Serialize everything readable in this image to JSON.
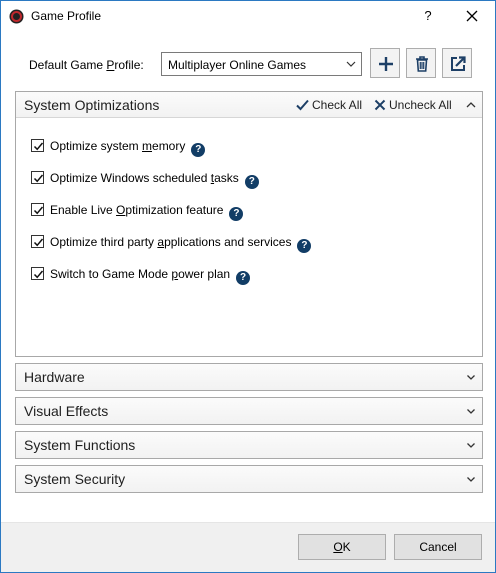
{
  "window": {
    "title": "Game Profile",
    "help_label": "?"
  },
  "profile": {
    "label_before": "Default Game ",
    "label_underlined": "P",
    "label_after": "rofile:",
    "selected": "Multiplayer Online Games"
  },
  "system_optimizations": {
    "title": "System Optimizations",
    "check_all": "Check All",
    "uncheck_all": "Uncheck All",
    "options": [
      {
        "pre": "Optimize system ",
        "u": "m",
        "post": "emory",
        "checked": true
      },
      {
        "pre": "Optimize Windows scheduled ",
        "u": "t",
        "post": "asks",
        "checked": true
      },
      {
        "pre": "Enable Live ",
        "u": "O",
        "post": "ptimization feature",
        "checked": true
      },
      {
        "pre": "Optimize third party ",
        "u": "a",
        "post": "pplications and services",
        "checked": true
      },
      {
        "pre": "Switch to Game Mode ",
        "u": "p",
        "post": "ower plan",
        "checked": true
      }
    ]
  },
  "groups": {
    "hardware": "Hardware",
    "visual_effects": "Visual Effects",
    "system_functions": "System Functions",
    "system_security": "System Security"
  },
  "footer": {
    "ok_underlined": "O",
    "ok_rest": "K",
    "cancel": "Cancel"
  },
  "colors": {
    "window_border": "#2b79c2",
    "help_badge": "#123d66",
    "icon_dark": "#1d3f66"
  }
}
